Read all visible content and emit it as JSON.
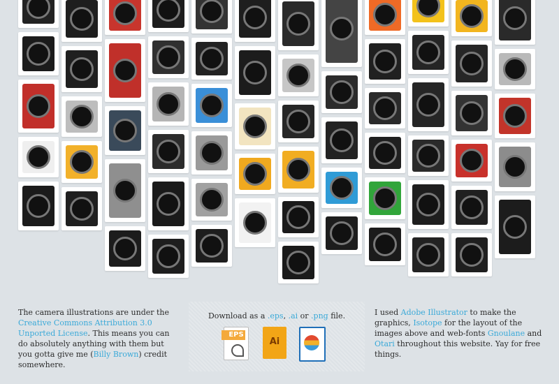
{
  "colors": {
    "background": "#dde2e6",
    "card": "#ffffff",
    "text": "#2b2b2b",
    "link": "#3aa9d8",
    "eps": "#f4a93b",
    "ai": "#f2a516",
    "png": "#1f6fb8"
  },
  "gallery": {
    "items": [
      {
        "icon": "camera-yellow-icon",
        "color": "#f3c21b"
      },
      {
        "icon": "camera-black-icon",
        "color": "#222222"
      },
      {
        "icon": "camera-dslr-icon",
        "color": "#1d1d1d"
      },
      {
        "icon": "camera-compact-icon",
        "color": "#333333"
      },
      {
        "icon": "camera-silver-icon",
        "color": "#444444"
      },
      {
        "icon": "camera-red-icon",
        "color": "#c8352d"
      },
      {
        "icon": "camera-black-icon",
        "color": "#2a2a2a"
      },
      {
        "icon": "camera-dslr-icon",
        "color": "#1e1e1e"
      },
      {
        "icon": "camera-orange-icon",
        "color": "#ef6a26"
      },
      {
        "icon": "camera-dslr-icon",
        "color": "#1e1e1e"
      },
      {
        "icon": "camera-yellow-icon",
        "color": "#f2b51f"
      },
      {
        "icon": "camera-compact-icon",
        "color": "#2a2a2a"
      },
      {
        "icon": "camera-black-icon",
        "color": "#252525"
      },
      {
        "icon": "camera-dslr-icon",
        "color": "#1b1b1b"
      },
      {
        "icon": "camera-compact-icon",
        "color": "#303030"
      },
      {
        "icon": "camera-black-icon",
        "color": "#222222"
      },
      {
        "icon": "camera-red-icon",
        "color": "#c0302a"
      },
      {
        "icon": "camera-dslr-icon",
        "color": "#202020"
      },
      {
        "icon": "camera-black-icon",
        "color": "#262626"
      },
      {
        "icon": "camera-dslr-icon",
        "color": "#1f1f1f"
      },
      {
        "icon": "camera-dslr-icon",
        "color": "#1c1c1c"
      },
      {
        "icon": "camera-silver-icon",
        "color": "#b9b9b9"
      },
      {
        "icon": "camera-silver-icon",
        "color": "#c6c6c6"
      },
      {
        "icon": "camera-instant-icon",
        "color": "#2b2b2b"
      },
      {
        "icon": "camera-instant-icon",
        "color": "#262626"
      },
      {
        "icon": "camera-red-icon",
        "color": "#c12f2a"
      },
      {
        "icon": "camera-silver-icon",
        "color": "#b5b5b5"
      },
      {
        "icon": "camera-blue-icon",
        "color": "#3a8fd8"
      },
      {
        "icon": "camera-black-icon",
        "color": "#2a2a2a"
      },
      {
        "icon": "camera-instant-icon",
        "color": "#333333"
      },
      {
        "icon": "camera-red-icon",
        "color": "#c2342a"
      },
      {
        "icon": "camera-silver-icon",
        "color": "#bdbdbd"
      },
      {
        "icon": "camera-polaroid-icon",
        "color": "#262626"
      },
      {
        "icon": "camera-polaroid-icon",
        "color": "#f2e4c0"
      },
      {
        "icon": "camera-polaroid-icon",
        "color": "#3a4a5a"
      },
      {
        "icon": "camera-polaroid-icon",
        "color": "#222222"
      },
      {
        "icon": "camera-polaroid-icon",
        "color": "#2b2b2b"
      },
      {
        "icon": "camera-silver-icon",
        "color": "#9a9a9a"
      },
      {
        "icon": "camera-polaroid-icon",
        "color": "#1f1f1f"
      },
      {
        "icon": "camera-polaroid-icon",
        "color": "#2a2a2a"
      },
      {
        "icon": "camera-polaroid-icon",
        "color": "#efefef"
      },
      {
        "icon": "camera-polaroid-icon",
        "color": "#c8312b"
      },
      {
        "icon": "camera-yellow-icon",
        "color": "#f2b12a"
      },
      {
        "icon": "camera-silver-icon",
        "color": "#8c8c8c"
      },
      {
        "icon": "camera-yellow-icon",
        "color": "#f1ad22"
      },
      {
        "icon": "camera-yellow-icon",
        "color": "#f0a91f"
      },
      {
        "icon": "camera-silver-icon",
        "color": "#8f8f8f"
      },
      {
        "icon": "camera-blue-icon",
        "color": "#2f9bd6"
      },
      {
        "icon": "lens-icon",
        "color": "#1a1a1a"
      },
      {
        "icon": "camera-green-icon",
        "color": "#31a53a"
      },
      {
        "icon": "camera-silver-icon",
        "color": "#a1a1a1"
      },
      {
        "icon": "lens-icon",
        "color": "#1e1e1e"
      },
      {
        "icon": "lens-icon",
        "color": "#1b1b1b"
      },
      {
        "icon": "lens-icon",
        "color": "#202020"
      },
      {
        "icon": "lens-icon",
        "color": "#1f1f1f"
      },
      {
        "icon": "lens-icon",
        "color": "#1c1c1c"
      },
      {
        "icon": "flash-icon",
        "color": "#1a1a1a"
      },
      {
        "icon": "lens-icon",
        "color": "#f2f2f2"
      },
      {
        "icon": "lens-icon",
        "color": "#1d1d1d"
      },
      {
        "icon": "flash-icon",
        "color": "#1b1b1b"
      },
      {
        "icon": "flash-icon",
        "color": "#1e1e1e"
      },
      {
        "icon": "flash-icon",
        "color": "#1c1c1c"
      },
      {
        "icon": "flash-icon",
        "color": "#222222"
      },
      {
        "icon": "flash-icon",
        "color": "#1f1f1f"
      },
      {
        "icon": "flash-icon",
        "color": "#1a1a1a"
      },
      {
        "icon": "ring-light-icon",
        "color": "#7a7a7a"
      },
      {
        "icon": "led-panel-icon",
        "color": "#1e1e1e"
      },
      {
        "icon": "photo-frame-icon",
        "color": "#1a1a1a"
      },
      {
        "icon": "film-pink-icon",
        "color": "#d1387f"
      },
      {
        "icon": "cable-icon",
        "color": "#c23b3b"
      },
      {
        "icon": "memory-card-icon",
        "color": "#2a56a8"
      },
      {
        "icon": "flash-icon",
        "color": "#1b1b1b"
      },
      {
        "icon": "flash-icon",
        "color": "#1e1e1e"
      },
      {
        "icon": "memory-card-icon",
        "color": "#2a2a5a"
      },
      {
        "icon": "memory-card-icon",
        "color": "#f2f2f2"
      },
      {
        "icon": "film-canister-icon",
        "color": "#e8e8e8"
      },
      {
        "icon": "film-canister-icon",
        "color": "#1e1e1e"
      },
      {
        "icon": "film-canister-icon",
        "color": "#2e9a46"
      },
      {
        "icon": "memory-card-icon",
        "color": "#2d2d2d"
      }
    ]
  },
  "license": {
    "t1": "The camera illustrations are under the ",
    "link1": "Creative Commons Attribution 3.0 Unported License",
    "t2": ". This means you can do absolutely anything with them but you gotta give me (",
    "link2": "Billy Brown",
    "t3": ") credit somewhere."
  },
  "download": {
    "pre": "Download as a ",
    "eps": ".eps",
    "sep1": ", ",
    "ai": ".ai",
    "or": " or ",
    "png": ".png",
    "post": " file.",
    "files": [
      {
        "label": "EPS",
        "icon": "eps-file-icon"
      },
      {
        "label": "Ai",
        "icon": "ai-file-icon"
      },
      {
        "label": "",
        "icon": "png-file-icon"
      }
    ]
  },
  "credits": {
    "t1": "I used ",
    "link1": "Adobe Illustrator",
    "t2": " to make the graphics, ",
    "link2": "Isotope",
    "t3": " for the layout of the images above and web-fonts ",
    "link3": "Gnoulane",
    "t4": " and ",
    "link4": "Otari",
    "t5": " throughout this website. Yay for free things."
  }
}
